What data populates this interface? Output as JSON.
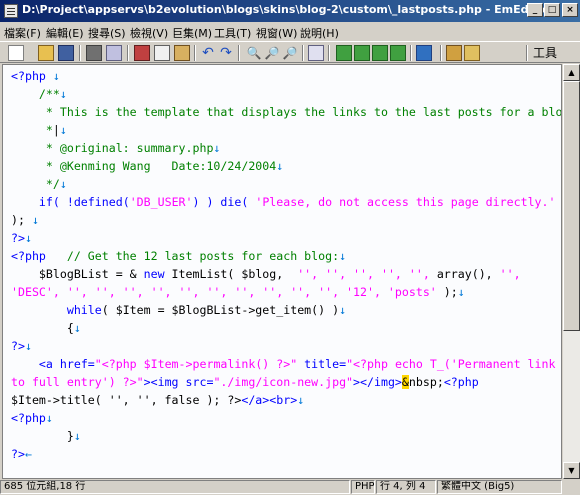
{
  "window": {
    "title": "D:\\Project\\appservs\\b2evolution\\blogs\\skins\\blog-2\\custom\\_lastposts.php - EmEditor"
  },
  "menu": [
    "檔案(F)",
    "編輯(E)",
    "搜尋(S)",
    "檢視(V)",
    "巨集(M)",
    "工具(T)",
    "視窗(W)",
    "說明(H)"
  ],
  "toolbar": {
    "tools_label": "工具"
  },
  "status": {
    "info": "685 位元組,18 行",
    "mode": "PHP",
    "position": "行 4, 列 4",
    "encoding": "繁體中文 (Big5)"
  },
  "code": [
    [
      {
        "t": "<?php",
        "c": "mk"
      },
      {
        "t": " ↓",
        "c": "nl"
      }
    ],
    [
      {
        "t": "    /**",
        "c": "cm"
      },
      {
        "t": "↓",
        "c": "nl"
      }
    ],
    [
      {
        "t": "     * This is the template that displays the links to the last posts for a blog",
        "c": "cm"
      },
      {
        "t": "↓",
        "c": "nl"
      }
    ],
    [
      {
        "t": "     *",
        "c": "cm"
      },
      {
        "t": "|",
        "c": "pt"
      },
      {
        "t": "↓",
        "c": "nl"
      }
    ],
    [
      {
        "t": "     * @original: summary.php",
        "c": "cm"
      },
      {
        "t": "↓",
        "c": "nl"
      }
    ],
    [
      {
        "t": "     * @Kenming Wang   Date:10/24/2004",
        "c": "cm"
      },
      {
        "t": "↓",
        "c": "nl"
      }
    ],
    [
      {
        "t": "     */",
        "c": "cm"
      },
      {
        "t": "↓",
        "c": "nl"
      }
    ],
    [
      {
        "t": "    if( !",
        "c": "kw"
      },
      {
        "t": "defined",
        "c": "kw"
      },
      {
        "t": "(",
        "c": "kw"
      },
      {
        "t": "'DB_USER'",
        "c": "st"
      },
      {
        "t": ") ) die( ",
        "c": "kw"
      },
      {
        "t": "'Please, do not access this page directly.'",
        "c": "st"
      }
    ],
    [
      {
        "t": "); ",
        "c": "pt"
      },
      {
        "t": "↓",
        "c": "nl"
      }
    ],
    [
      {
        "t": "?>",
        "c": "mk"
      },
      {
        "t": "↓",
        "c": "nl"
      }
    ],
    [
      {
        "t": "<?php",
        "c": "mk"
      },
      {
        "t": "   // Get the 12 last posts for each blog:",
        "c": "cm"
      },
      {
        "t": "↓",
        "c": "nl"
      }
    ],
    [
      {
        "t": "    $BlogBList = & ",
        "c": "pt"
      },
      {
        "t": "new",
        "c": "kw"
      },
      {
        "t": " ItemList( $blog,  ",
        "c": "pt"
      },
      {
        "t": "'', '', '', '', '', ",
        "c": "st"
      },
      {
        "t": "array(), ",
        "c": "pt"
      },
      {
        "t": "'',",
        "c": "st"
      }
    ],
    [
      {
        "t": "'DESC', '', '', '', '', '', '', '', '', '', '', '12', 'posts'",
        "c": "st"
      },
      {
        "t": " );",
        "c": "pt"
      },
      {
        "t": "↓",
        "c": "nl"
      }
    ],
    [
      {
        "t": "        ",
        "c": "pt"
      },
      {
        "t": "while",
        "c": "kw"
      },
      {
        "t": "( $Item = $BlogBList->get_item() )",
        "c": "pt"
      },
      {
        "t": "↓",
        "c": "nl"
      }
    ],
    [
      {
        "t": "        {",
        "c": "pt"
      },
      {
        "t": "↓",
        "c": "nl"
      }
    ],
    [
      {
        "t": "?>",
        "c": "mk"
      },
      {
        "t": "↓",
        "c": "nl"
      }
    ],
    [
      {
        "t": "    <a ",
        "c": "mk"
      },
      {
        "t": "href=",
        "c": "mk"
      },
      {
        "t": "\"<?php $Item->permalink() ?>\"",
        "c": "st"
      },
      {
        "t": " title=",
        "c": "mk"
      },
      {
        "t": "\"<?php echo T_('Permanent link",
        "c": "st"
      }
    ],
    [
      {
        "t": "to full entry') ?>\"",
        "c": "st"
      },
      {
        "t": "><img ",
        "c": "mk"
      },
      {
        "t": "src=",
        "c": "mk"
      },
      {
        "t": "\"./img/icon-new.jpg\"",
        "c": "st"
      },
      {
        "t": "></img>",
        "c": "mk"
      },
      {
        "t": "&",
        "c": "hl"
      },
      {
        "t": "nbsp;",
        "c": "pt"
      },
      {
        "t": "<?php",
        "c": "mk"
      }
    ],
    [
      {
        "t": "$Item->title( '', '', false ); ?>",
        "c": "pt"
      },
      {
        "t": "</a><br>",
        "c": "mk"
      },
      {
        "t": "↓",
        "c": "nl"
      }
    ],
    [
      {
        "t": "<?php",
        "c": "mk"
      },
      {
        "t": "↓",
        "c": "nl"
      }
    ],
    [
      {
        "t": "        }",
        "c": "pt"
      },
      {
        "t": "↓",
        "c": "nl"
      }
    ],
    [
      {
        "t": "?>",
        "c": "mk"
      },
      {
        "t": "←",
        "c": "nl"
      }
    ]
  ]
}
